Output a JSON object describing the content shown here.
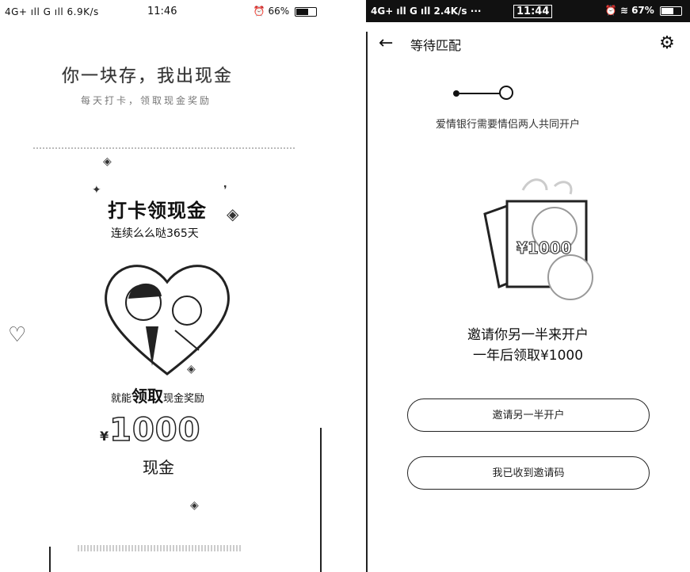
{
  "left_screen": {
    "status": {
      "signal_text": "4G+ ıll  G ıll 6.9K/s",
      "time": "11:46",
      "battery_text": "66%",
      "battery_level": 0.66
    },
    "title": "你一块存，我出现金",
    "subtitle": "每天打卡，领取现金奖励",
    "card_title": "打卡领现金",
    "card_subtitle": "连续么么哒365天",
    "desc_prefix": "就能",
    "desc_big": "领取",
    "desc_suffix": "现金奖励",
    "amount_currency": "¥",
    "amount": "1000",
    "cash_label": "现金"
  },
  "right_screen": {
    "status": {
      "signal_text": "4G+ ıll  G ıll 2.4K/s ···",
      "time": "11:44",
      "battery_text": "67%",
      "battery_level": 0.67
    },
    "header": {
      "back_icon": "←",
      "title": "等待匹配",
      "settings_icon": "⚙"
    },
    "step_text": "爱情银行需要情侣两人共同开户",
    "money_label": "¥1000",
    "invite_text": "邀请你另一半来开户",
    "receive_text": "一年后领取¥1000",
    "buttons": {
      "invite_label": "邀请另一半开户",
      "secondary_label": "我已收到邀请码"
    }
  }
}
